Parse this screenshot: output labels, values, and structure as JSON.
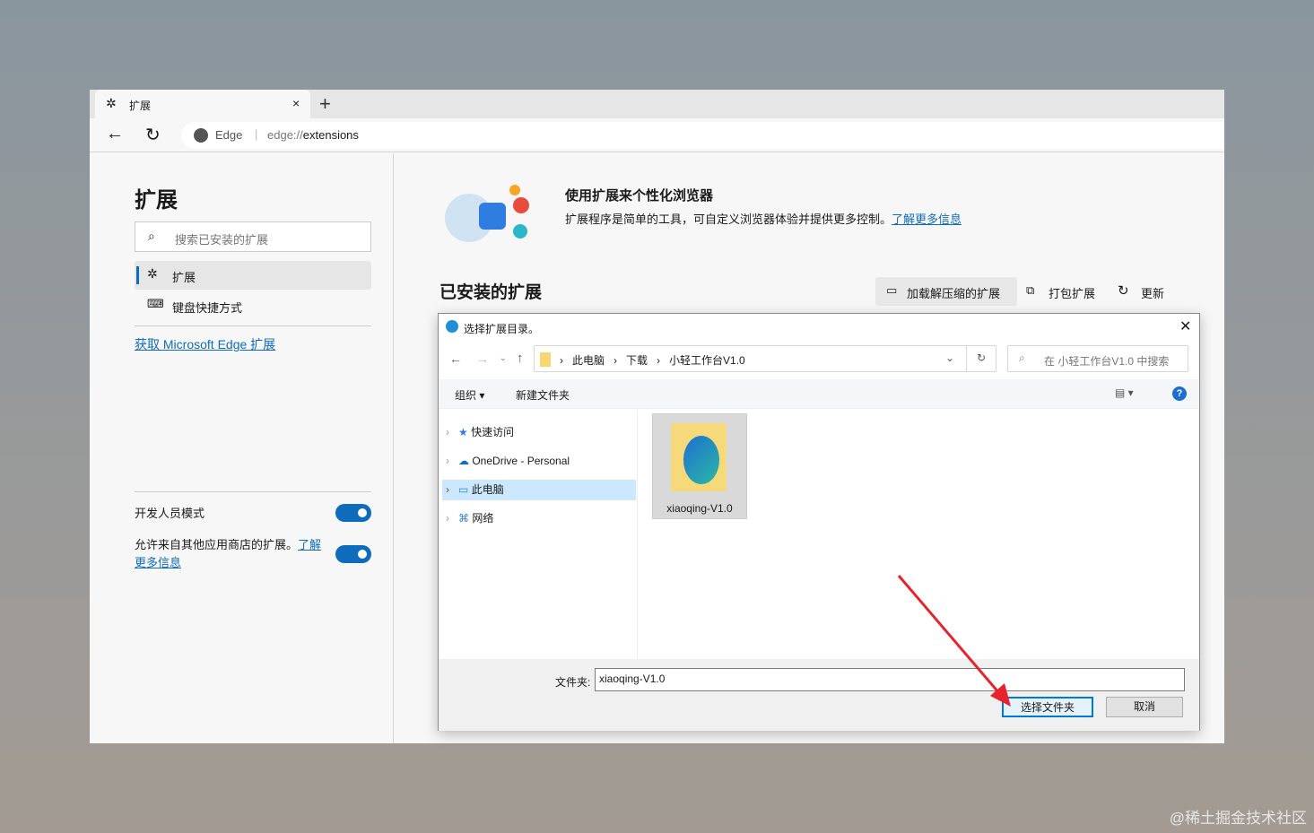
{
  "browser": {
    "tab_title": "扩展",
    "address_prefix": "Edge",
    "address_url_dim": "edge://",
    "address_url": "extensions"
  },
  "sidebar": {
    "title": "扩展",
    "search_placeholder": "搜索已安装的扩展",
    "items": [
      {
        "label": "扩展"
      },
      {
        "label": "键盘快捷方式"
      }
    ],
    "get_link": "获取 Microsoft Edge 扩展",
    "dev_mode_label": "开发人员模式",
    "dev_mode_on": true,
    "allow_other_label": "允许来自其他应用商店的扩展。",
    "allow_other_link": "了解更多信息",
    "allow_other_on": true
  },
  "main": {
    "promo_title": "使用扩展来个性化浏览器",
    "promo_text": "扩展程序是简单的工具，可自定义浏览器体验并提供更多控制。",
    "promo_link": "了解更多信息",
    "installed_title": "已安装的扩展",
    "load_unpacked": "加载解压缩的扩展",
    "pack": "打包扩展",
    "update": "更新"
  },
  "dialog": {
    "title": "选择扩展目录。",
    "breadcrumb": [
      "此电脑",
      "下载",
      "小轻工作台V1.0"
    ],
    "search_placeholder": "在 小轻工作台V1.0 中搜索",
    "organize": "组织",
    "new_folder": "新建文件夹",
    "nav": [
      "快速访问",
      "OneDrive - Personal",
      "此电脑",
      "网络"
    ],
    "selected_nav": "此电脑",
    "files": [
      {
        "name": "xiaoqing-V1.0"
      }
    ],
    "folder_label": "文件夹:",
    "folder_value": "xiaoqing-V1.0",
    "select_button": "选择文件夹",
    "cancel_button": "取消"
  },
  "watermark": "@稀土掘金技术社区"
}
